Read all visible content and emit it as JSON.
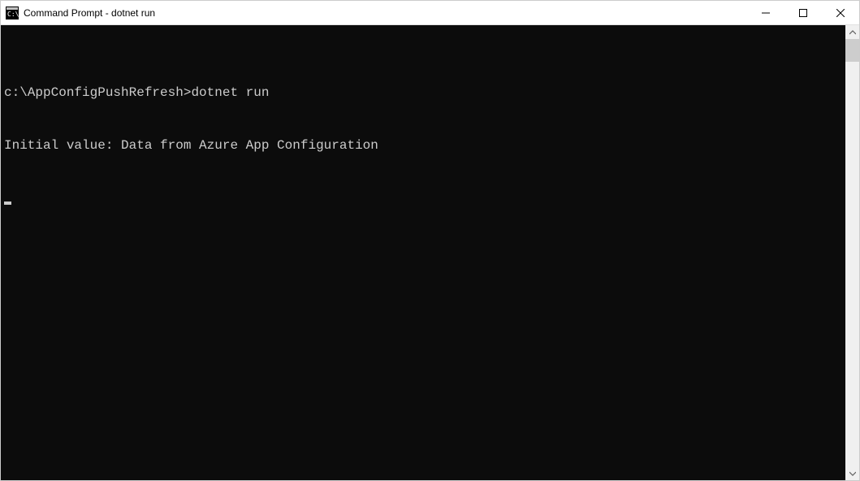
{
  "window": {
    "title": "Command Prompt - dotnet  run"
  },
  "terminal": {
    "prompt": "c:\\AppConfigPushRefresh>",
    "command": "dotnet run",
    "output_line_1": "Initial value: Data from Azure App Configuration"
  }
}
